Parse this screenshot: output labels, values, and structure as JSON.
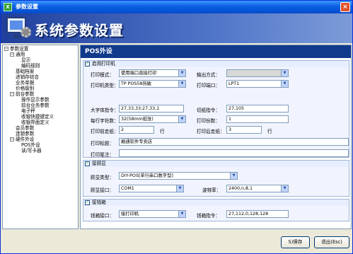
{
  "window": {
    "title": "参数设置",
    "app_icon": "X",
    "close_icon": "close-x"
  },
  "banner": {
    "title": "系统参数设置"
  },
  "tree": {
    "items": [
      {
        "label": "参数设置",
        "level": 0,
        "toggle": "−"
      },
      {
        "label": "通用",
        "level": 1,
        "toggle": "−"
      },
      {
        "label": "显示",
        "level": 2
      },
      {
        "label": "编码规则",
        "level": 2
      },
      {
        "label": "基础档案",
        "level": 1
      },
      {
        "label": "进销存综合",
        "level": 1
      },
      {
        "label": "业务单据",
        "level": 1
      },
      {
        "label": "价格级别",
        "level": 1
      },
      {
        "label": "前台参数",
        "level": 1,
        "toggle": "−"
      },
      {
        "label": "操作显示参数",
        "level": 2
      },
      {
        "label": "前台业务参数",
        "level": 2
      },
      {
        "label": "电子秤",
        "level": 2
      },
      {
        "label": "收银快捷键定义",
        "level": 2
      },
      {
        "label": "收银界面定义",
        "level": 2
      },
      {
        "label": "会员参数",
        "level": 1
      },
      {
        "label": "连锁参数",
        "level": 1
      },
      {
        "label": "硬件外设",
        "level": 1,
        "toggle": "−"
      },
      {
        "label": "POS外设",
        "level": 2
      },
      {
        "label": "读/写卡器",
        "level": 2
      }
    ]
  },
  "content": {
    "title": "POS外设",
    "printer_section": {
      "enable_label": "启用打印机",
      "mode_label": "打印模式：",
      "mode_value": "使用端口直接打印",
      "output_label": "输出方式：",
      "output_value": "",
      "type_label": "打印机类型：",
      "type_value": "TP POS58热敏",
      "port_label": "打印端口：",
      "port_value": "LPT1",
      "font_label": "大字体指令：",
      "font_value": "27,33,33;27,33,1",
      "cut_label": "切纸指令：",
      "cut_value": "27,105",
      "width_label": "每行字符数：",
      "width_value": "32(58mm纸张)",
      "copies_label": "打印份数：",
      "copies_value": "1",
      "before_label": "打印前走纸：",
      "before_value": "2",
      "after_label": "打印后走纸：",
      "after_value": "3",
      "unit": "行",
      "header_label": "打印标题：",
      "header_value": "巅通软件专卖店",
      "footer_label": "打印尾注：",
      "footer_value": ""
    },
    "display_section": {
      "enable_label": "接顾显",
      "type_label": "顾显类型：",
      "type_value": "DIY-POS[单行串口数字型]",
      "port_label": "顾显接口：",
      "port_value": "COM1",
      "baud_label": "波特率：",
      "baud_value": "2400,n,8,1"
    },
    "drawer_section": {
      "enable_label": "接钱箱",
      "port_label": "钱箱接口：",
      "port_value": "接打印机",
      "cmd_label": "钱箱指令：",
      "cmd_value": "27,112,0,128,128"
    }
  },
  "buttons": {
    "save": "S)保存",
    "exit": "退出(Esc)"
  }
}
